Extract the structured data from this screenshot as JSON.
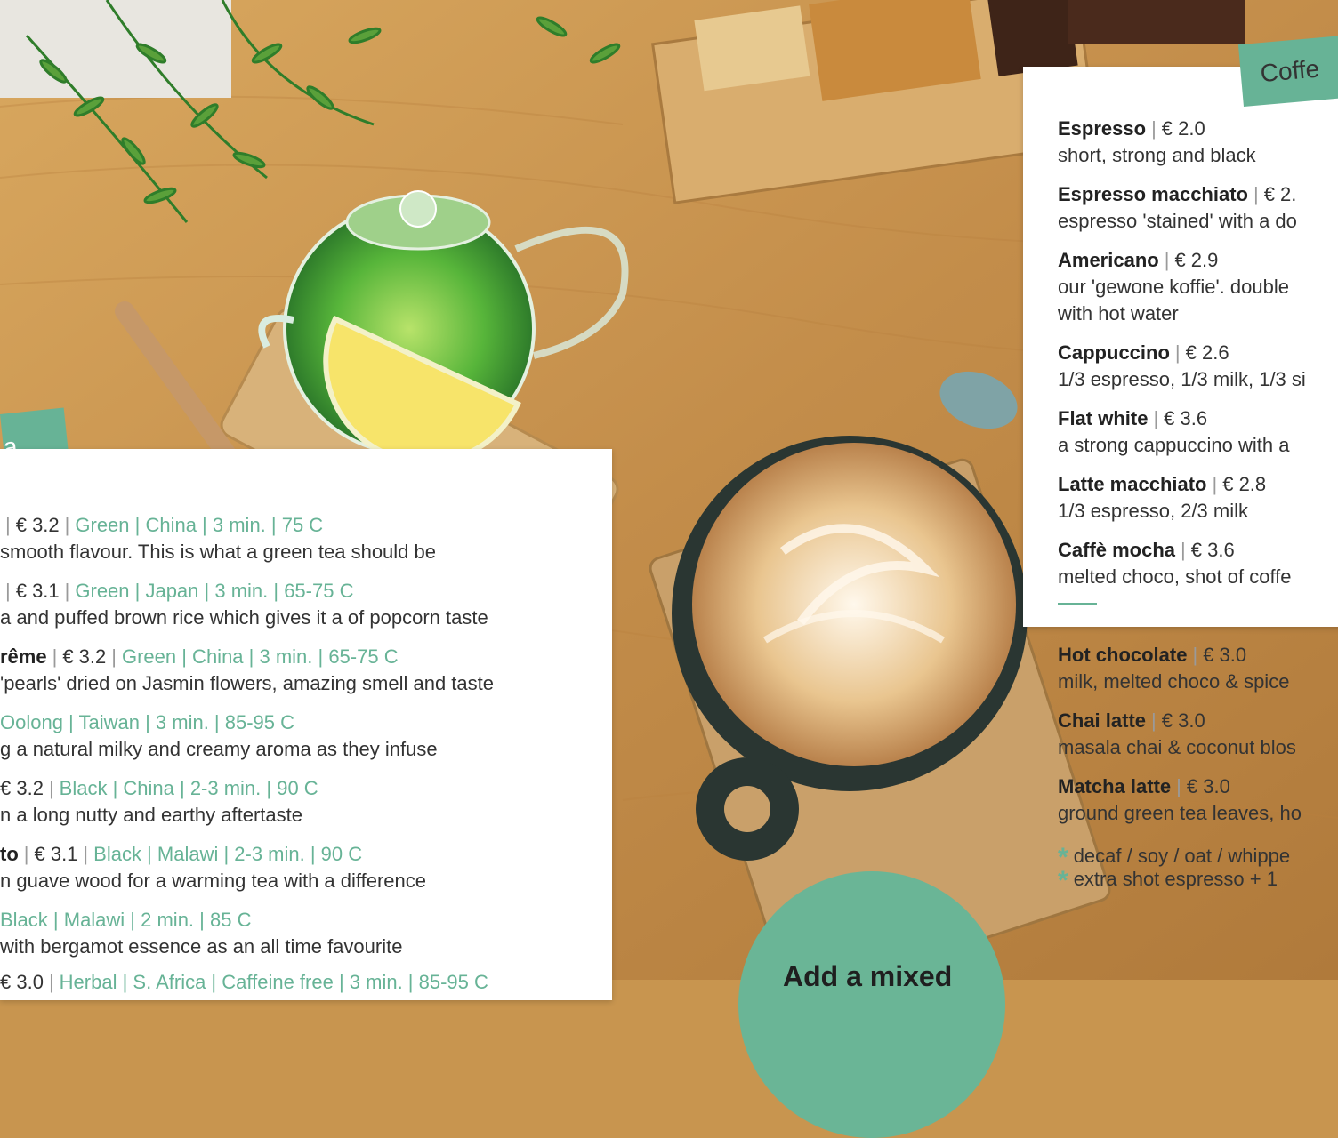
{
  "tea": {
    "tab_label": "a",
    "items": [
      {
        "name": "",
        "price": "€ 3.2",
        "meta": "Green | China  |  3 min. | 75 C",
        "desc": "smooth flavour. This is what a green tea should be"
      },
      {
        "name": "",
        "price": "€ 3.1",
        "meta": "Green | Japan | 3 min. | 65-75 C",
        "desc": "a and puffed brown rice which gives it a of popcorn taste"
      },
      {
        "name": "rême",
        "price": "€ 3.2",
        "meta": "Green | China | 3 min. | 65-75 C",
        "desc": "'pearls' dried on Jasmin flowers, amazing smell and taste"
      },
      {
        "name": "",
        "price": "",
        "meta": "Oolong | Taiwan | 3 min. |  85-95 C",
        "desc": "g a natural milky and creamy aroma as they infuse"
      },
      {
        "name": "",
        "price": "€ 3.2",
        "meta": "Black | China | 2-3 min. | 90 C",
        "desc": "n a long nutty and earthy aftertaste"
      },
      {
        "name": "to",
        "price": "€ 3.1",
        "meta": "Black | Malawi | 2-3 min. | 90 C",
        "desc": "n guave wood for a warming tea with a difference"
      },
      {
        "name": "",
        "price": "",
        "meta": "Black | Malawi | 2 min. | 85 C",
        "desc": "with bergamot essence as an all time favourite"
      },
      {
        "name": "",
        "price": "€ 3.0",
        "meta": "Herbal | S. Africa | Caffeine free | 3 min. | 85-95 C",
        "desc": ""
      }
    ]
  },
  "coffee": {
    "tab_label": "Coffe",
    "items": [
      {
        "name": "Espresso",
        "price": "€ 2.0",
        "desc": "short, strong and black"
      },
      {
        "name": "Espresso macchiato",
        "price": "€ 2.",
        "desc": "espresso 'stained' with a do"
      },
      {
        "name": "Americano",
        "price": "€ 2.9",
        "desc": "our 'gewone koffie'. double",
        "desc2": "with hot water"
      },
      {
        "name": "Cappuccino",
        "price": "€ 2.6",
        "desc": "1/3 espresso, 1/3 milk, 1/3 si"
      },
      {
        "name": "Flat white",
        "price": "€ 3.6",
        "desc": "a strong cappuccino with a"
      },
      {
        "name": "Latte macchiato",
        "price": "€ 2.8",
        "desc": "1/3 espresso, 2/3 milk"
      },
      {
        "name": "Caffè mocha",
        "price": "€ 3.6",
        "desc": "melted choco, shot of coffe"
      },
      {
        "name": "Hot chocolate",
        "price": "€ 3.0",
        "desc": "milk, melted choco &  spice"
      },
      {
        "name": "Chai latte",
        "price": "€ 3.0",
        "desc": "masala chai & coconut blos"
      },
      {
        "name": "Matcha latte",
        "price": "€ 3.0",
        "desc": "ground green tea leaves, ho"
      }
    ],
    "notes": [
      "decaf / soy / oat / whippe",
      "extra shot espresso + 1"
    ]
  },
  "promo": {
    "text": "Add a mixed"
  },
  "colors": {
    "accent": "#67b396",
    "wood": "#c8954f"
  }
}
